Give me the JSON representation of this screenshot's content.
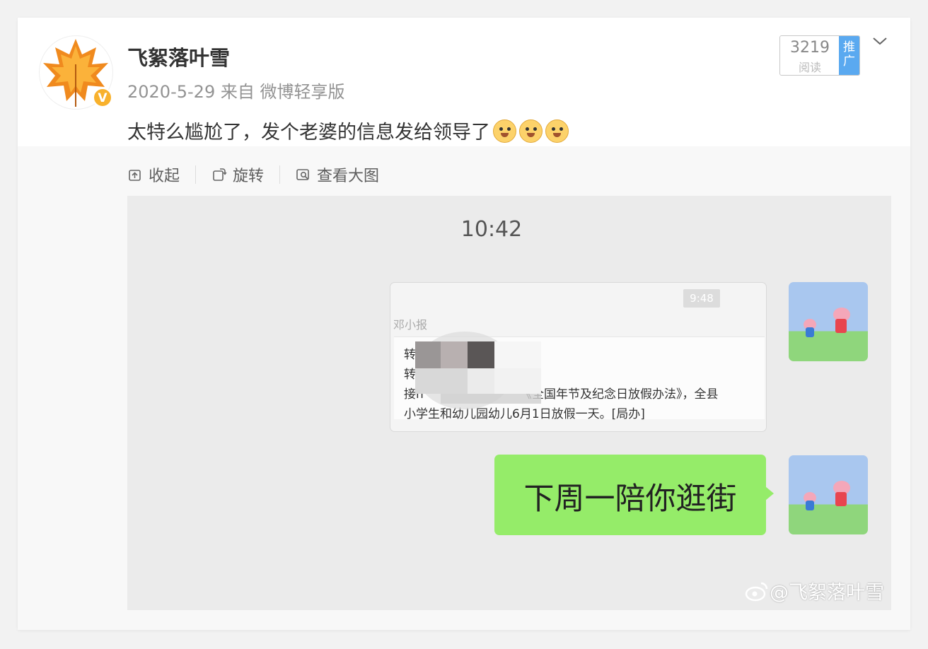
{
  "post": {
    "username": "飞絮落叶雪",
    "meta": "2020-5-29 来自 微博轻享版",
    "text": "太特么尴尬了，发个老婆的信息发给领导了",
    "emoji_count": 3,
    "emoji_icon": "doge-emoji-icon",
    "verified_badge": "V",
    "read_count": "3219",
    "read_label": "阅读",
    "promote_label": "推广"
  },
  "toolbar": {
    "collapse_label": "收起",
    "rotate_label": "旋转",
    "view_large_label": "查看大图"
  },
  "chat_image": {
    "clock": "10:42",
    "forward_card": {
      "time": "9:48",
      "sender": "邓小报",
      "line1": "转",
      "line2": "转",
      "line3_start": "接n",
      "line3_end": "《全国年节及纪念日放假办法》，全县",
      "line4": "小学生和幼儿园幼儿6月1日放假一天。[局办]"
    },
    "bubble_text": "下周一陪你逛街",
    "watermark": "@飞絮落叶雪"
  },
  "colors": {
    "bubble_green": "#95ec69",
    "promote_blue": "#5aa9f0",
    "verified_gold": "#f8b12c"
  }
}
